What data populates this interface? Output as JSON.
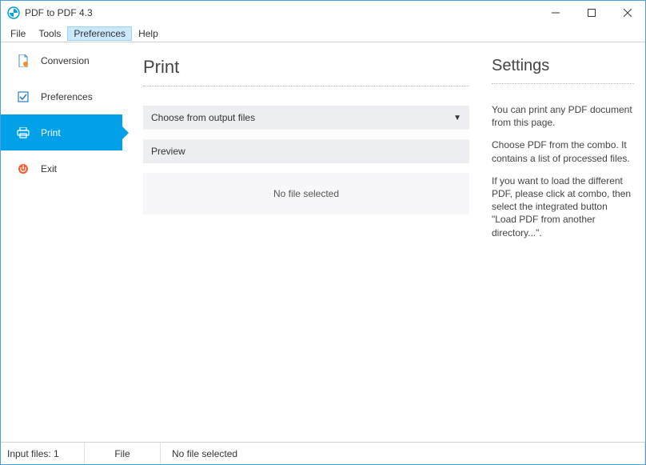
{
  "window": {
    "title": "PDF to PDF 4.3"
  },
  "menu": {
    "items": [
      "File",
      "Tools",
      "Preferences",
      "Help"
    ],
    "activeIndex": 2
  },
  "sidebar": {
    "items": [
      {
        "label": "Conversion"
      },
      {
        "label": "Preferences"
      },
      {
        "label": "Print"
      },
      {
        "label": "Exit"
      }
    ],
    "activeIndex": 2
  },
  "main": {
    "title": "Print",
    "combo_label": "Choose from output files",
    "preview_label": "Preview",
    "preview_empty": "No file selected"
  },
  "settings": {
    "title": "Settings",
    "p1": "You can print any PDF document from this page.",
    "p2": "Choose PDF from the combo. It contains a list of processed files.",
    "p3": "If you want to load the different PDF, please click at combo, then select the integrated button \"Load PDF from another directory...\"."
  },
  "status": {
    "input_label": "Input files:  1",
    "file_button": "File",
    "message": "No file selected"
  }
}
